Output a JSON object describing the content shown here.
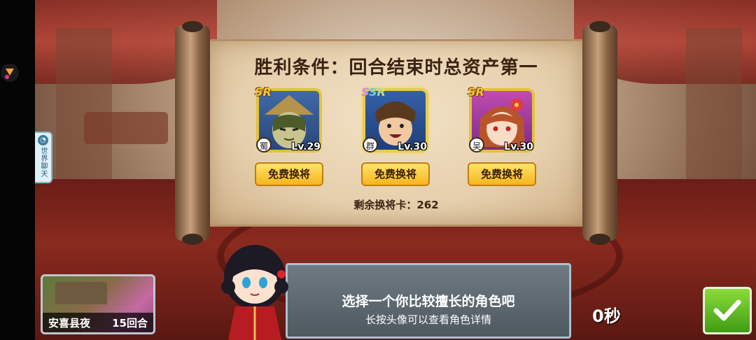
{
  "victory": {
    "title": "胜利条件：回合结束时总资产第一"
  },
  "heroes": [
    {
      "rarity": "SR",
      "faction": "蜀",
      "level": "Lv.29",
      "swap_label": "免费换将",
      "frame_color": "#e4c23a"
    },
    {
      "rarity": "SSR",
      "faction": "群",
      "level": "Lv.30",
      "swap_label": "免费换将",
      "frame_color": "#eacb4a"
    },
    {
      "rarity": "SR",
      "faction": "吴",
      "level": "Lv.30",
      "swap_label": "免费换将",
      "frame_color": "#e4c23a"
    }
  ],
  "remaining_cards": "剩余换将卡：262",
  "side_panel": {
    "world_chat_label": "世界聊天"
  },
  "map": {
    "name": "安喜县夜",
    "rounds": "15回合"
  },
  "dialog": {
    "line1": "选择一个你比较擅长的角色吧",
    "line2": "长按头像可以查看角色详情"
  },
  "timer": "0秒",
  "colors": {
    "confirm_green": "#3f9c14",
    "button_gold": "#f6b51e",
    "title_brown": "#3b2312"
  },
  "icons": {
    "confirm": "checkmark-icon",
    "chat": "chat-bubble-icon"
  }
}
